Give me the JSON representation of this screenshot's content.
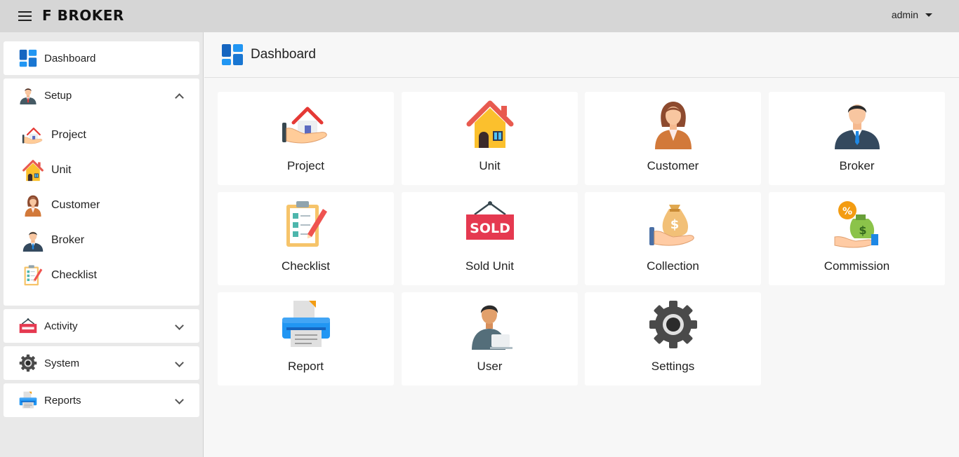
{
  "header": {
    "logo_text": "F  BROKER",
    "user_label": "admin"
  },
  "sidebar": {
    "dashboard": {
      "label": "Dashboard",
      "icon": "dashboard-icon"
    },
    "setup": {
      "label": "Setup",
      "icon": "manager-icon",
      "expanded": true,
      "items": [
        {
          "label": "Project",
          "icon": "house-hand-icon"
        },
        {
          "label": "Unit",
          "icon": "house-icon"
        },
        {
          "label": "Customer",
          "icon": "woman-icon"
        },
        {
          "label": "Broker",
          "icon": "businessman-icon"
        },
        {
          "label": "Checklist",
          "icon": "checklist-icon"
        }
      ]
    },
    "activity": {
      "label": "Activity",
      "icon": "sold-sign-icon",
      "expanded": false
    },
    "system": {
      "label": "System",
      "icon": "gear-icon",
      "expanded": false
    },
    "reports": {
      "label": "Reports",
      "icon": "printer-icon",
      "expanded": false
    }
  },
  "main": {
    "title": "Dashboard",
    "tiles": [
      {
        "label": "Project",
        "icon": "house-hand-icon"
      },
      {
        "label": "Unit",
        "icon": "house-icon"
      },
      {
        "label": "Customer",
        "icon": "woman-icon"
      },
      {
        "label": "Broker",
        "icon": "businessman-icon"
      },
      {
        "label": "Checklist",
        "icon": "checklist-icon"
      },
      {
        "label": "Sold Unit",
        "icon": "sold-sign-icon",
        "sign_text": "SOLD"
      },
      {
        "label": "Collection",
        "icon": "money-bag-hand-icon"
      },
      {
        "label": "Commission",
        "icon": "commission-icon"
      },
      {
        "label": "Report",
        "icon": "printer-icon"
      },
      {
        "label": "User",
        "icon": "user-laptop-icon"
      },
      {
        "label": "Settings",
        "icon": "gear-icon"
      }
    ]
  },
  "colors": {
    "accent_blue": "#1e88e5",
    "sold_red": "#e53950",
    "topbar": "#d6d6d6"
  }
}
